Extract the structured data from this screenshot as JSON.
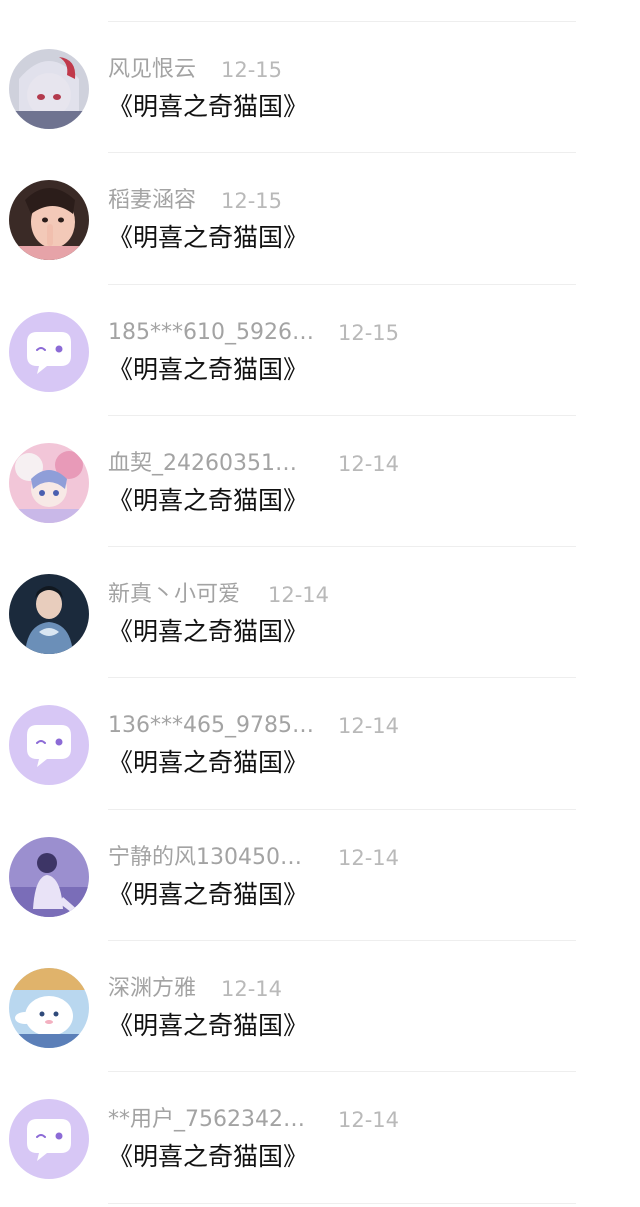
{
  "conversations": [
    {
      "username": "风见恨云",
      "date": "12-15",
      "message": "《明喜之奇猫国》",
      "avatar": "avatar-photo-anime-girl",
      "colors": [
        "#d9d9e3",
        "#8b8fa6",
        "#c0394b"
      ]
    },
    {
      "username": "稻妻涵容",
      "date": "12-15",
      "message": "《明喜之奇猫国》",
      "avatar": "avatar-photo-girl",
      "colors": [
        "#f3c9b8",
        "#3a2a26",
        "#e6a3a8"
      ]
    },
    {
      "username": "185***610_5926…",
      "date": "12-15",
      "message": "《明喜之奇猫国》",
      "avatar": "default-chat-icon",
      "colors": [
        "#d7c7f5",
        "#ffffff",
        "#8c6bd6"
      ]
    },
    {
      "username": "血契_24260351…",
      "date": "12-14",
      "message": "《明喜之奇猫国》",
      "avatar": "avatar-photo-anime-group",
      "colors": [
        "#f2c6d8",
        "#8f9ed8",
        "#f6f0f2"
      ]
    },
    {
      "username": "新真丶小可爱",
      "date": "12-14",
      "message": "《明喜之奇猫国》",
      "avatar": "avatar-photo-boy",
      "colors": [
        "#1b2a3c",
        "#6b8fb8",
        "#d9e6f2"
      ]
    },
    {
      "username": "136***465_9785…",
      "date": "12-14",
      "message": "《明喜之奇猫国》",
      "avatar": "default-chat-icon",
      "colors": [
        "#d7c7f5",
        "#ffffff",
        "#8c6bd6"
      ]
    },
    {
      "username": "宁静的风130450…",
      "date": "12-14",
      "message": "《明喜之奇猫国》",
      "avatar": "avatar-photo-person-purple",
      "colors": [
        "#9b8fcf",
        "#e9e3f7",
        "#3d3566"
      ]
    },
    {
      "username": "深渊方雅",
      "date": "12-14",
      "message": "《明喜之奇猫国》",
      "avatar": "avatar-photo-cinnamoroll",
      "colors": [
        "#b9d7ef",
        "#ffffff",
        "#e0b36b"
      ]
    },
    {
      "username": "**用户_7562342…",
      "date": "12-14",
      "message": "《明喜之奇猫国》",
      "avatar": "default-chat-icon",
      "colors": [
        "#d7c7f5",
        "#ffffff",
        "#8c6bd6"
      ]
    }
  ]
}
